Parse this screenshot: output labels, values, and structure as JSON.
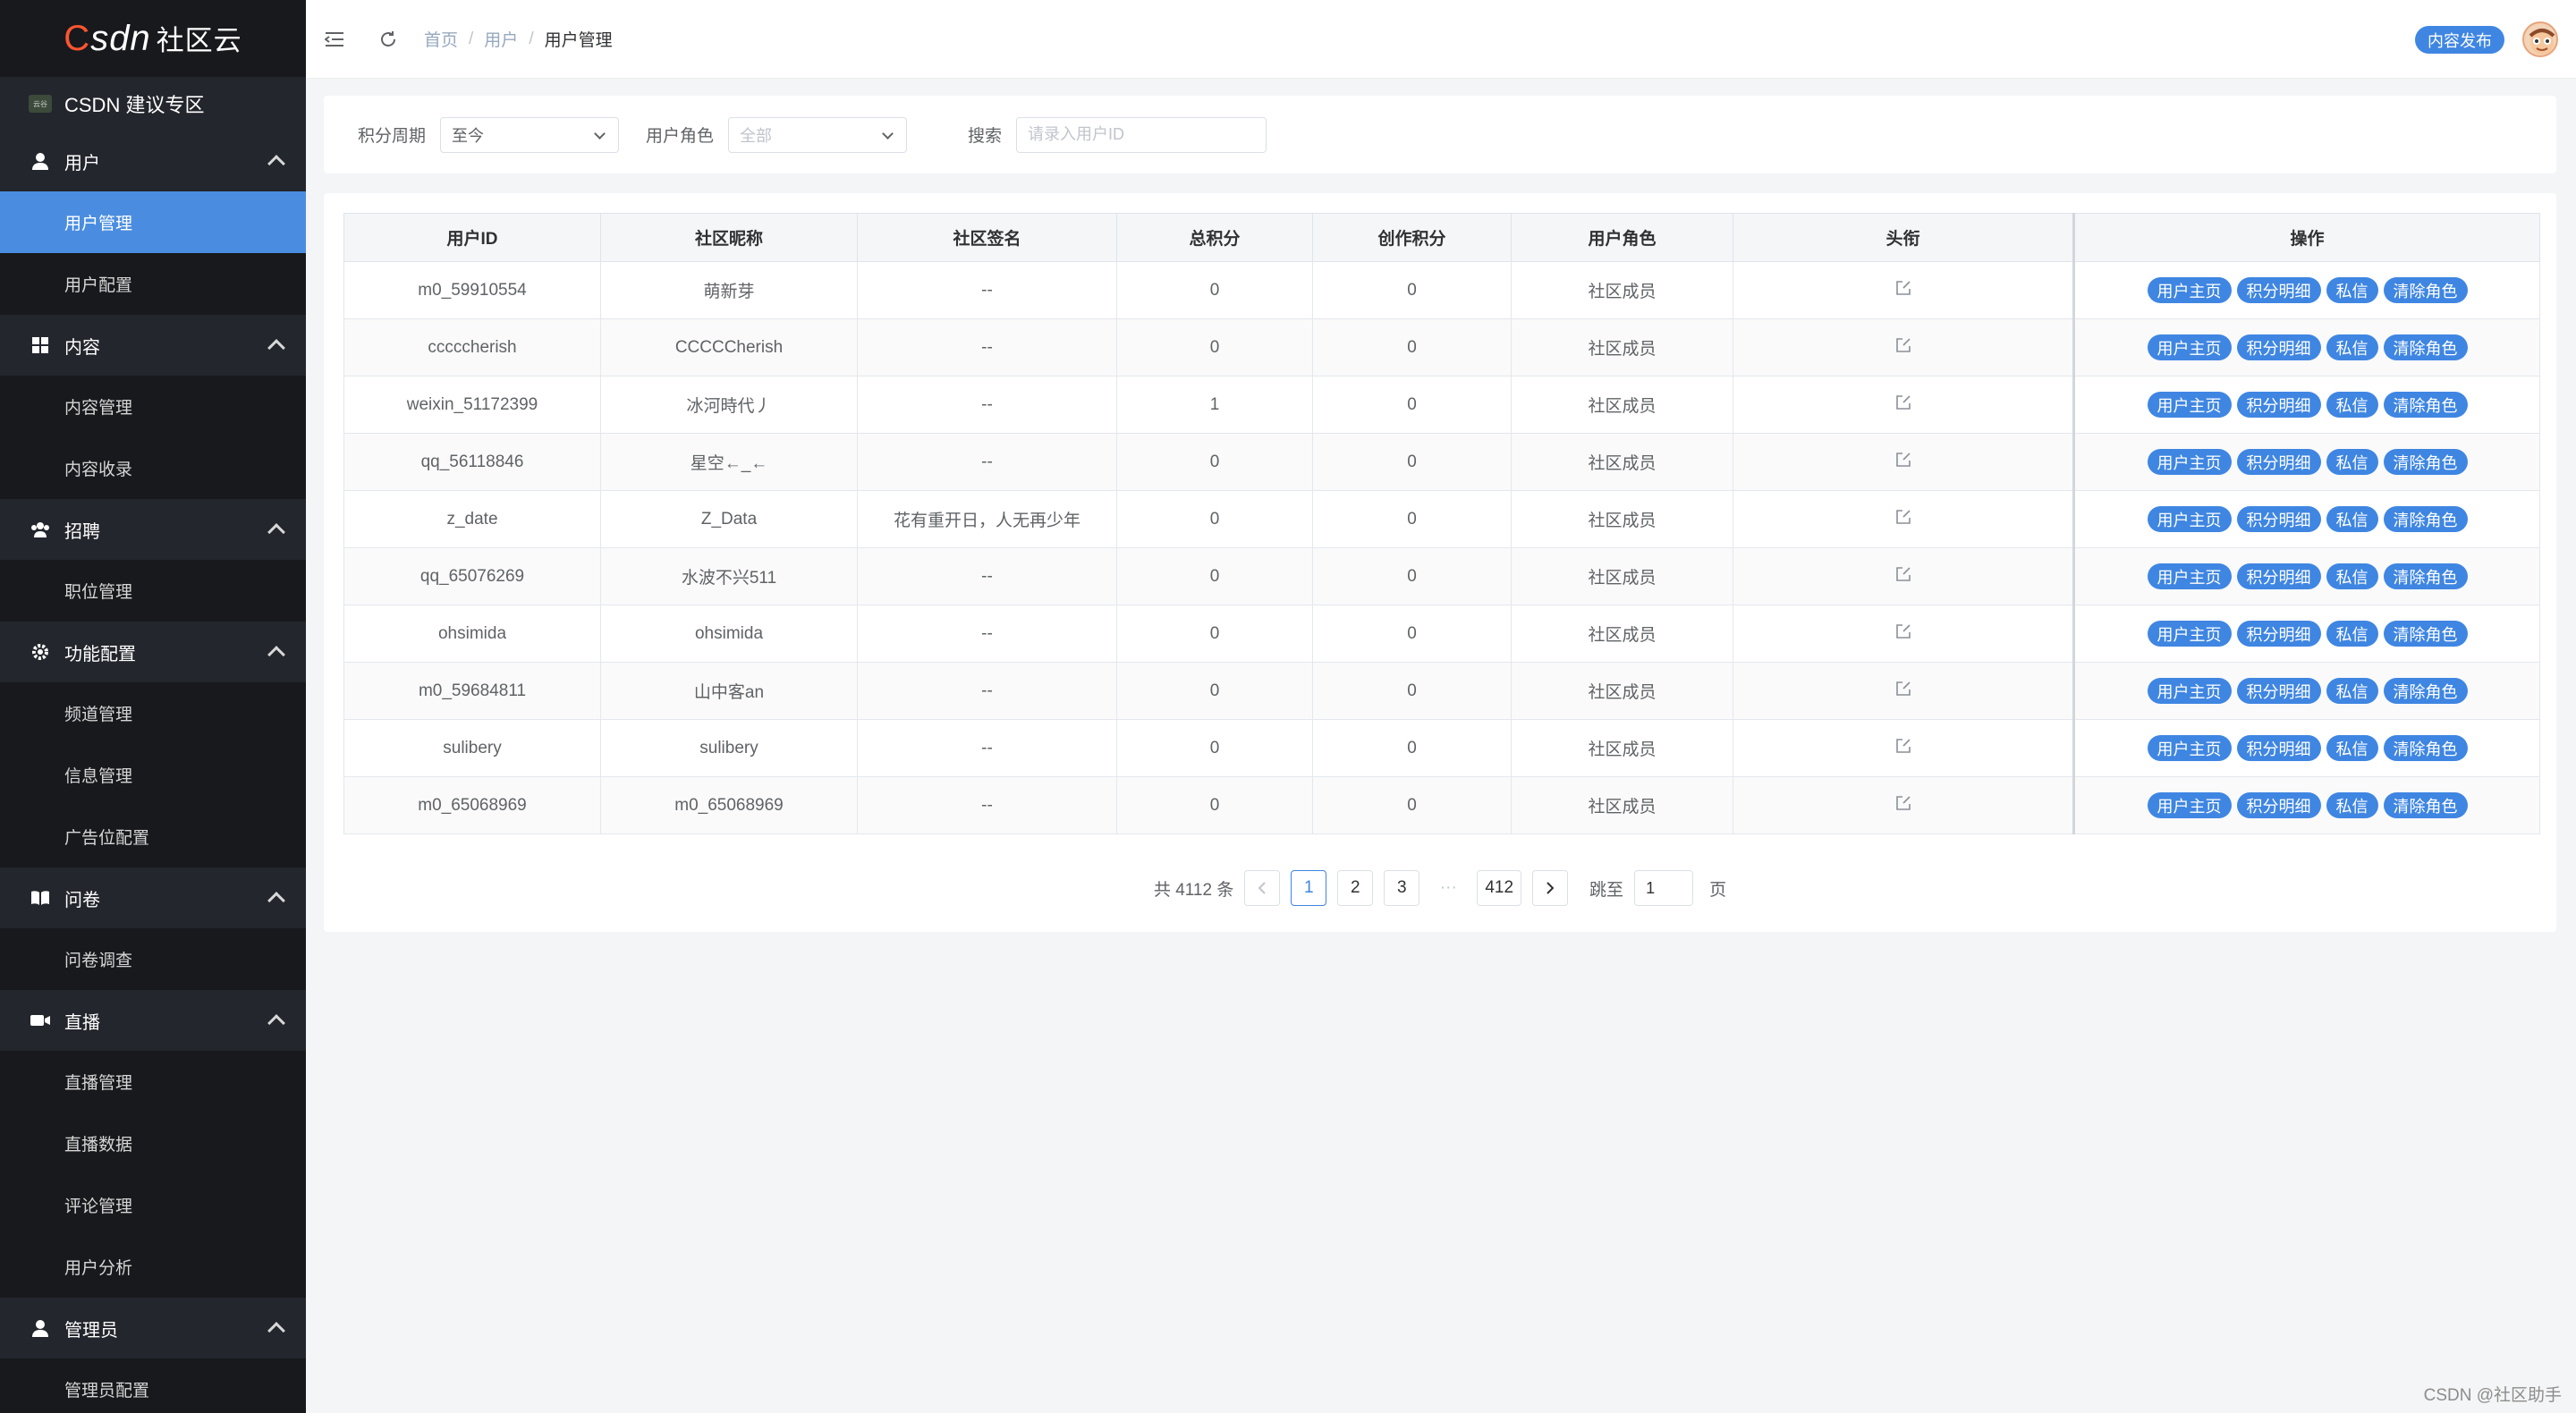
{
  "logo": {
    "c": "C",
    "sdn": "SDN",
    "suffix": "社区云"
  },
  "zone": {
    "badge": "云谷",
    "label": "CSDN 建议专区"
  },
  "sidebar": {
    "groups": [
      {
        "label": "用户",
        "icon": "user-icon",
        "items": [
          {
            "label": "用户管理",
            "active": true
          },
          {
            "label": "用户配置"
          }
        ]
      },
      {
        "label": "内容",
        "icon": "grid-icon",
        "items": [
          {
            "label": "内容管理"
          },
          {
            "label": "内容收录"
          }
        ]
      },
      {
        "label": "招聘",
        "icon": "team-icon",
        "items": [
          {
            "label": "职位管理"
          }
        ]
      },
      {
        "label": "功能配置",
        "icon": "gear-icon",
        "items": [
          {
            "label": "频道管理"
          },
          {
            "label": "信息管理"
          },
          {
            "label": "广告位配置"
          }
        ]
      },
      {
        "label": "问卷",
        "icon": "book-icon",
        "items": [
          {
            "label": "问卷调查"
          }
        ]
      },
      {
        "label": "直播",
        "icon": "video-icon",
        "items": [
          {
            "label": "直播管理"
          },
          {
            "label": "直播数据"
          },
          {
            "label": "评论管理"
          },
          {
            "label": "用户分析"
          }
        ]
      },
      {
        "label": "管理员",
        "icon": "user-icon",
        "items": [
          {
            "label": "管理员配置"
          }
        ]
      }
    ]
  },
  "header": {
    "breadcrumb": [
      "首页",
      "用户",
      "用户管理"
    ],
    "publish_label": "内容发布"
  },
  "filters": {
    "period_label": "积分周期",
    "period_value": "至今",
    "role_label": "用户角色",
    "role_placeholder": "全部",
    "search_label": "搜索",
    "search_placeholder": "请录入用户ID"
  },
  "table": {
    "columns": [
      "用户ID",
      "社区昵称",
      "社区签名",
      "总积分",
      "创作积分",
      "用户角色",
      "头衔",
      "操作"
    ],
    "actions": [
      "用户主页",
      "积分明细",
      "私信",
      "清除角色"
    ],
    "rows": [
      {
        "id": "m0_59910554",
        "nick": "萌新芽",
        "sign": "--",
        "total": "0",
        "create": "0",
        "role": "社区成员"
      },
      {
        "id": "cccccherish",
        "nick": "CCCCCherish",
        "sign": "--",
        "total": "0",
        "create": "0",
        "role": "社区成员"
      },
      {
        "id": "weixin_51172399",
        "nick": "冰河時代丿",
        "sign": "--",
        "total": "1",
        "create": "0",
        "role": "社区成员"
      },
      {
        "id": "qq_56118846",
        "nick": "星空←_←",
        "sign": "--",
        "total": "0",
        "create": "0",
        "role": "社区成员"
      },
      {
        "id": "z_date",
        "nick": "Z_Data",
        "sign": "花有重开日，人无再少年",
        "total": "0",
        "create": "0",
        "role": "社区成员"
      },
      {
        "id": "qq_65076269",
        "nick": "水波不兴511",
        "sign": "--",
        "total": "0",
        "create": "0",
        "role": "社区成员"
      },
      {
        "id": "ohsimida",
        "nick": "ohsimida",
        "sign": "--",
        "total": "0",
        "create": "0",
        "role": "社区成员"
      },
      {
        "id": "m0_59684811",
        "nick": "山中客an",
        "sign": "--",
        "total": "0",
        "create": "0",
        "role": "社区成员"
      },
      {
        "id": "sulibery",
        "nick": "sulibery",
        "sign": "--",
        "total": "0",
        "create": "0",
        "role": "社区成员"
      },
      {
        "id": "m0_65068969",
        "nick": "m0_65068969",
        "sign": "--",
        "total": "0",
        "create": "0",
        "role": "社区成员"
      }
    ]
  },
  "pagination": {
    "total_text": "共 4112 条",
    "pages": [
      "1",
      "2",
      "3"
    ],
    "current": "1",
    "ellipsis": "···",
    "last_page": "412",
    "jump_label": "跳至",
    "jump_value": "1",
    "page_suffix": "页"
  },
  "watermark": "CSDN @社区助手",
  "colors": {
    "accent": "#3f86e2",
    "sidebar_bg": "#17191d",
    "sidebar_group_bg": "#23262c",
    "brand_red": "#fc5531"
  }
}
